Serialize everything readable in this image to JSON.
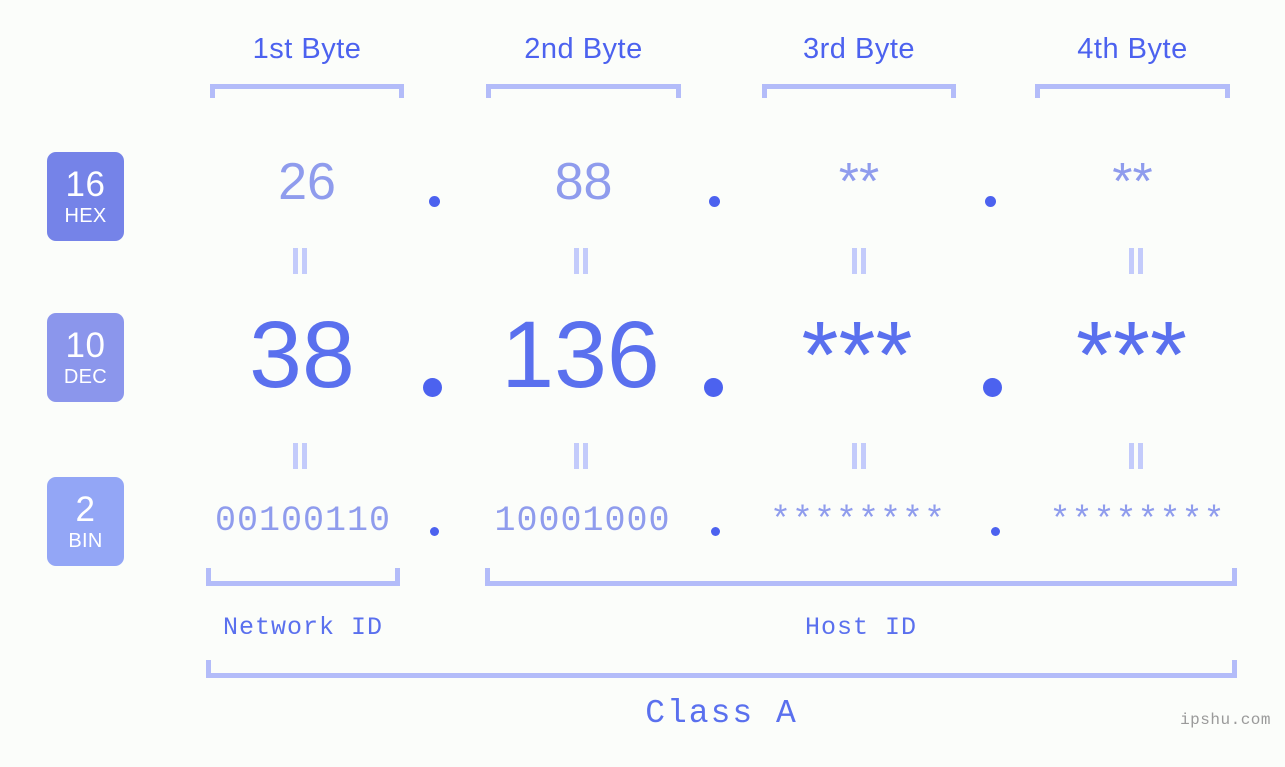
{
  "meta": {
    "background": "#fbfdfa",
    "accent_dark": "#4c62ef",
    "accent_mid": "#5a70ee",
    "accent_light": "#8f9ced",
    "accent_pale": "#b3bcf9",
    "watermark": "ipshu.com"
  },
  "byte_headers": [
    {
      "label": "1st Byte"
    },
    {
      "label": "2nd Byte"
    },
    {
      "label": "3rd Byte"
    },
    {
      "label": "4th Byte"
    }
  ],
  "radix_rows": [
    {
      "base": "16",
      "name": "HEX",
      "color": "#7583e8"
    },
    {
      "base": "10",
      "name": "DEC",
      "color": "#8b96ec"
    },
    {
      "base": "2",
      "name": "BIN",
      "color": "#93a6f6"
    }
  ],
  "values": {
    "hex": [
      "26",
      "88",
      "**",
      "**"
    ],
    "dec": [
      "38",
      "136",
      "***",
      "***"
    ],
    "bin": [
      "00100110",
      "10001000",
      "********",
      "********"
    ]
  },
  "separators": {
    "hex": [
      ".",
      ".",
      "."
    ],
    "dec": [
      ".",
      ".",
      "."
    ],
    "bin": [
      ".",
      ".",
      "."
    ]
  },
  "captions": {
    "network_id": "Network ID",
    "host_id": "Host ID",
    "class": "Class A"
  }
}
